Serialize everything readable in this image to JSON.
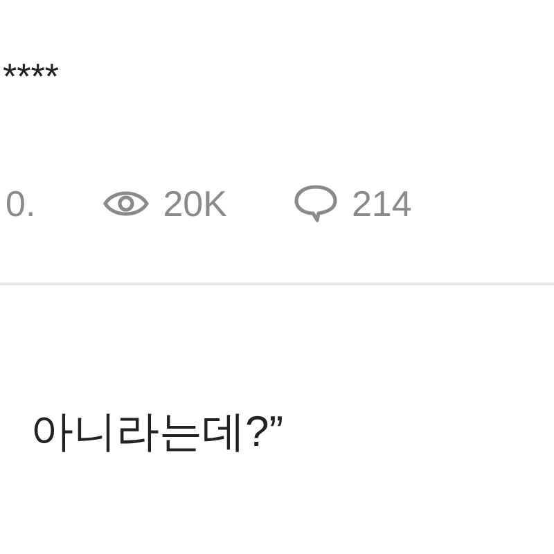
{
  "post": {
    "title": "****",
    "stats": [
      {
        "kind": "date",
        "text": "0."
      },
      {
        "kind": "views",
        "text": "20K"
      },
      {
        "kind": "comments",
        "text": "214"
      }
    ]
  },
  "body": {
    "text": "아니라는데?”"
  }
}
